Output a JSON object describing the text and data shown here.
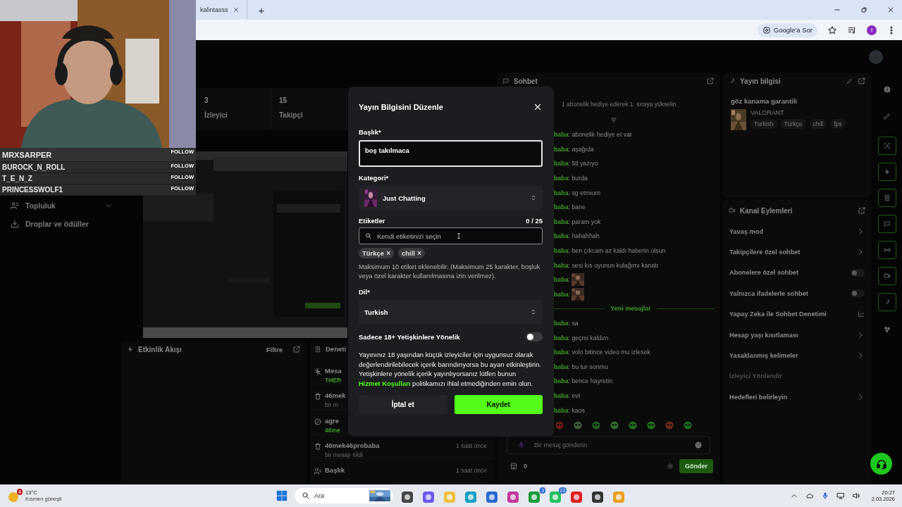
{
  "browser": {
    "tab_title": "kalintasss",
    "new_tab": "+",
    "address_chip": "Google'a Sor",
    "profile_initial": "I"
  },
  "webcam": {
    "kind": "picture",
    "followers": [
      {
        "name": "MRXSARPER",
        "action": "FOLLOW"
      },
      {
        "name": "BUROCK_N_ROLL",
        "action": "FOLLOW"
      },
      {
        "name": "T_E_N_Z",
        "action": "FOLLOW"
      },
      {
        "name": "PRINCESSWOLF1",
        "action": "FOLLOW"
      }
    ]
  },
  "sidebar": {
    "items": [
      {
        "label": "Topluluk",
        "kind": "group"
      },
      {
        "label": "Droplar ve ödüller",
        "kind": "drops"
      }
    ]
  },
  "stats": [
    {
      "value": "3",
      "label": "İzleyici"
    },
    {
      "value": "15",
      "label": "Takipçi"
    }
  ],
  "activity_feed": {
    "title": "Etkinlik Akışı",
    "filter": "Filtre"
  },
  "moderation": {
    "title": "Deneti",
    "events": [
      {
        "kind": "filter",
        "title": "Mesa",
        "detail": "THER",
        "detail_user": true
      },
      {
        "kind": "delete",
        "title": "46mek",
        "detail": "bir m",
        "detail_user": false
      },
      {
        "kind": "ban",
        "title": "agre",
        "detail": "46me",
        "detail_user": true
      },
      {
        "kind": "delete",
        "title": "46mek46probaba",
        "time": "1 saat önce",
        "detail": "bir mesajı sildi",
        "detail_user": false
      },
      {
        "kind": "title",
        "title": "Başlık",
        "time": "1 saat önce"
      }
    ]
  },
  "chat": {
    "title": "Sohbet",
    "banner": "1 abonelik hediye ederek 1. sıraya yükselin",
    "messages": [
      {
        "kind": "text",
        "user": "baba",
        "text": ": abonelik hediye et var"
      },
      {
        "kind": "text",
        "user": "baba",
        "text": ": aşağıda"
      },
      {
        "kind": "text",
        "user": "baba",
        "text": ": 5tl yazıyo"
      },
      {
        "kind": "text",
        "user": "baba",
        "text": ": burda"
      },
      {
        "kind": "text",
        "user": "baba",
        "text": ": sg etmiom"
      },
      {
        "kind": "text",
        "user": "baba",
        "text": ": bane"
      },
      {
        "kind": "text",
        "user": "baba",
        "text": ": param yok"
      },
      {
        "kind": "text",
        "user": "baba",
        "text": ": hahahhah"
      },
      {
        "kind": "text",
        "user": "baba",
        "text": ": ben çıkcam az kaldı haberin olsun"
      },
      {
        "kind": "text",
        "user": "baba",
        "text": ": sesi kıs oyunun kulağımı kanatı"
      },
      {
        "kind": "emote",
        "user": "baba",
        "text": ":"
      },
      {
        "kind": "emote",
        "user": "baba",
        "text": ":"
      },
      {
        "kind": "divider",
        "text": "Yeni mesajlar"
      },
      {
        "kind": "text",
        "user": "baba",
        "text": ": sa"
      },
      {
        "kind": "text",
        "user": "baba",
        "text": ": geçmi kaldım"
      },
      {
        "kind": "text",
        "user": "baba",
        "text": ": volo bitince video mu izlesek"
      },
      {
        "kind": "text",
        "user": "baba",
        "text": ": bu tur sonmu"
      },
      {
        "kind": "text",
        "user": "baba",
        "text": ": bence hayretin"
      },
      {
        "kind": "text",
        "user": "baba",
        "text": ": evt"
      },
      {
        "kind": "text",
        "user": "baba",
        "text": ": kaos"
      }
    ],
    "placeholder": "Bir mesaj gönderin",
    "points": "0",
    "send": "Gönder"
  },
  "stream_info": {
    "title": "Yayın bilgisi",
    "stream_title": "göz kanama garantili",
    "category": "VALORANT",
    "tags": [
      "Turkish",
      "Türkçe",
      "chill",
      "fps"
    ]
  },
  "channel_actions": {
    "title": "Kanal Eylemleri",
    "items": [
      {
        "label": "Yavaş mod",
        "kind": "arrow",
        "disabled": false
      },
      {
        "label": "Takipçilere özel sohbet",
        "kind": "arrow",
        "disabled": false
      },
      {
        "label": "Abonelere özel sohbet",
        "kind": "toggle",
        "on": false,
        "disabled": false
      },
      {
        "label": "Yalnızca ifadelerle sohbet",
        "kind": "toggle",
        "on": false,
        "disabled": false
      },
      {
        "label": "Yapay Zeka ile Sohbet Denetimi",
        "kind": "link",
        "disabled": false
      },
      {
        "label": "Hesap yaşı kısıtlaması",
        "kind": "arrow",
        "disabled": false
      },
      {
        "label": "Yasaklanmış kelimeler",
        "kind": "arrow",
        "disabled": false
      },
      {
        "label": "İzleyici Yönlendir",
        "kind": "plain",
        "disabled": true
      },
      {
        "label": "Hedefleri belirleyin",
        "kind": "arrow",
        "disabled": false
      }
    ]
  },
  "modal": {
    "title": "Yayın Bilgisini Düzenle",
    "title_label": "Başlık*",
    "title_value": "boş takılmaca",
    "category_label": "Kategori*",
    "category": "Just Chatting",
    "tags_label": "Etiketler",
    "tags_count": "0 / 25",
    "tags_placeholder": "Kendi etiketinizi seçin",
    "tags": [
      {
        "label": "Türkçe",
        "remove": "×"
      },
      {
        "label": "chill",
        "remove": "×"
      }
    ],
    "tags_help": "Maksimum 10 etiket eklenebilir. (Maksimum 25 karakter, boşluk veya özel karakter kullanılmasına izin verilmez).",
    "language_label": "Dil*",
    "language": "Turkish",
    "mature_label": "Sadece 18+ Yetişkinlere Yönelik",
    "mature_on": false,
    "mature_text": "Yayınınız 18 yaşından küçük izleyiciler için uygunsuz olarak değerlendirilebilecek içerik barındırıyorsa bu ayarı etkinleştirin. Yetişkinlere yönelik içerik yayınlıyorsanız lütfen bunun ",
    "mature_link": "Hizmet Koşulları",
    "mature_text_end": " politikamızı ihlal etmediğinden emin olun.",
    "cancel": "İptal et",
    "save": "Kaydet"
  },
  "taskbar": {
    "weather_badge": "4",
    "temperature": "13°C",
    "weather": "Kısmen güneşli",
    "search": "Ara",
    "apps": [
      {
        "kind": "taskview"
      },
      {
        "kind": "copilot"
      },
      {
        "kind": "folder"
      },
      {
        "kind": "edge"
      },
      {
        "kind": "store"
      },
      {
        "kind": "instagram"
      },
      {
        "kind": "xbox",
        "badge": "3"
      },
      {
        "kind": "whatsapp",
        "badge": "23"
      },
      {
        "kind": "youtube"
      },
      {
        "kind": "game"
      },
      {
        "kind": "chrome"
      }
    ],
    "time": "20:27",
    "date": "2.03.2026"
  }
}
